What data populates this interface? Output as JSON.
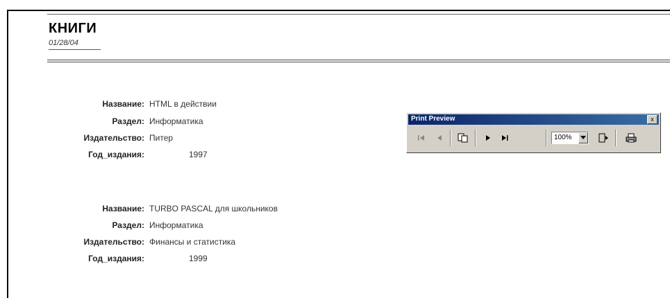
{
  "report": {
    "title": "КНИГИ",
    "date": "01/28/04"
  },
  "records": [
    {
      "name_label": "Название:",
      "name": "HTML в действии",
      "section_label": "Раздел:",
      "section": "Информатика",
      "publisher_label": "Издательство:",
      "publisher": "Питер",
      "year_label": "Год_издания:",
      "year": "1997"
    },
    {
      "name_label": "Название:",
      "name": "TURBO PASCAL для школьников",
      "section_label": "Раздел:",
      "section": "Информатика",
      "publisher_label": "Издательство:",
      "publisher": "Финансы и статистика",
      "year_label": "Год_издания:",
      "year": "1999"
    }
  ],
  "print_preview": {
    "title": "Print Preview",
    "close_label": "x",
    "zoom": "100%",
    "icons": [
      "first-page-icon",
      "prev-page-icon",
      "two-pages-icon",
      "next-page-icon",
      "last-page-icon",
      "zoom-dropdown-icon",
      "close-preview-icon",
      "print-icon"
    ]
  }
}
